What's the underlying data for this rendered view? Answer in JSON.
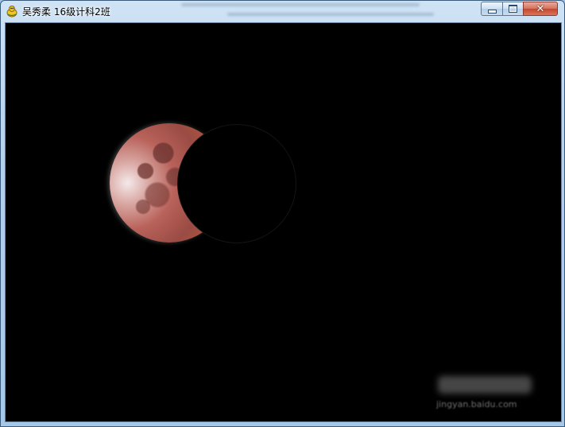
{
  "window": {
    "title": "吴秀柔 16级计科2班",
    "app_icon": "pygame-snake-icon",
    "controls": {
      "minimize_icon": "minimize-icon",
      "maximize_icon": "maximize-icon",
      "close_glyph": "✕"
    }
  },
  "canvas": {
    "background_color": "#000000",
    "moon_color": "#b8625a",
    "shadow_color": "#000000"
  },
  "watermark": {
    "text": "jingyan.baidu.com"
  }
}
